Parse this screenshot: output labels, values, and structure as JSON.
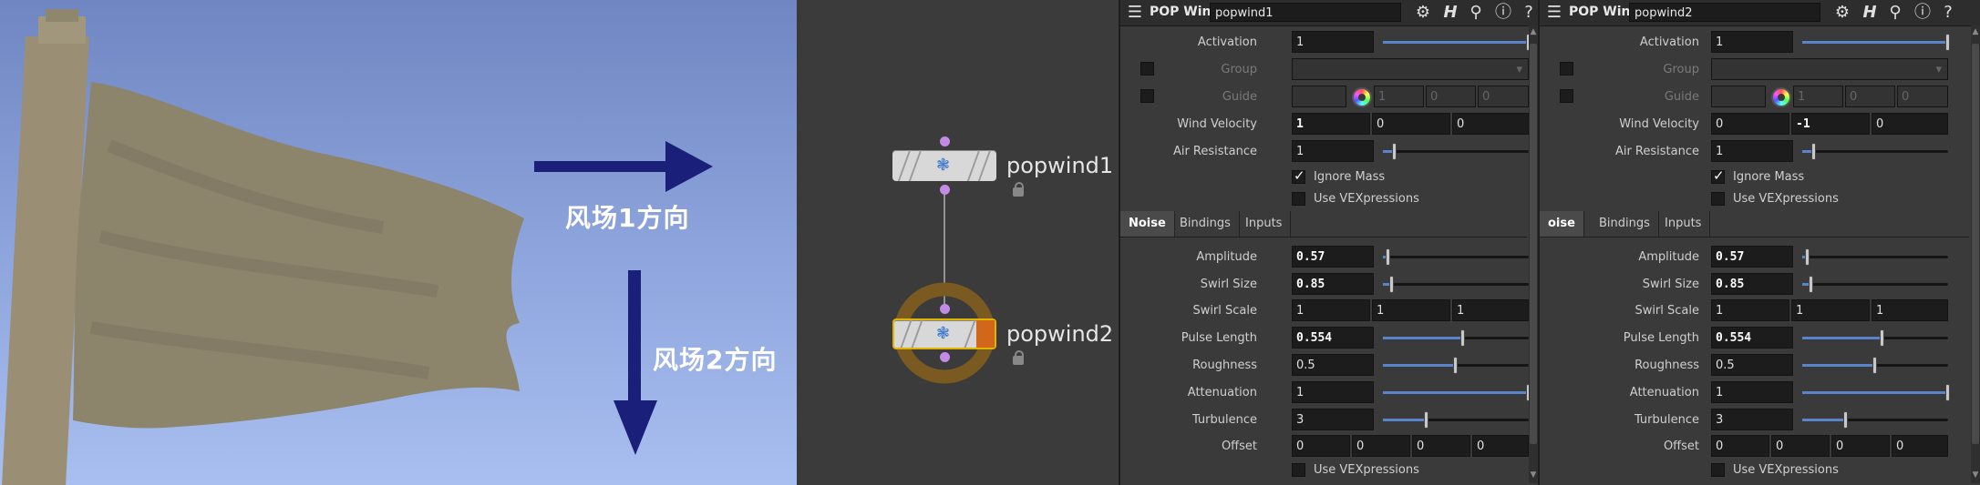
{
  "viewport": {
    "wind1_label": "风场1方向",
    "wind2_label": "风场2方向"
  },
  "network": {
    "nodes": [
      {
        "name": "popwind1"
      },
      {
        "name": "popwind2"
      }
    ]
  },
  "panels": [
    {
      "type_title": "POP Wind",
      "node_name": "popwind1",
      "params": {
        "activation": {
          "label": "Activation",
          "value": "1",
          "slider": 1.0
        },
        "group": {
          "label": "Group"
        },
        "guide": {
          "label": "Guide",
          "v1": "1",
          "v2": "0",
          "v3": "0"
        },
        "wind_velocity": {
          "label": "Wind Velocity",
          "x": "1",
          "y": "0",
          "z": "0"
        },
        "air_resistance": {
          "label": "Air Resistance",
          "value": "1",
          "slider": 0.08
        },
        "ignore_mass": {
          "label": "Ignore Mass",
          "checked": true
        },
        "use_vex": {
          "label": "Use VEXpressions",
          "checked": false
        }
      },
      "tabs": [
        "Noise",
        "Bindings",
        "Inputs"
      ],
      "noise": {
        "amplitude": {
          "label": "Amplitude",
          "value": "0.57",
          "slider": 0.04
        },
        "swirl_size": {
          "label": "Swirl Size",
          "value": "0.85",
          "slider": 0.06
        },
        "swirl_scale": {
          "label": "Swirl Scale",
          "v1": "1",
          "v2": "1",
          "v3": "1"
        },
        "pulse_length": {
          "label": "Pulse Length",
          "value": "0.554",
          "slider": 0.55
        },
        "roughness": {
          "label": "Roughness",
          "value": "0.5",
          "slider": 0.5
        },
        "attenuation": {
          "label": "Attenuation",
          "value": "1",
          "slider": 1.0
        },
        "turbulence": {
          "label": "Turbulence",
          "value": "3",
          "slider": 0.3
        },
        "offset": {
          "label": "Offset",
          "v1": "0",
          "v2": "0",
          "v3": "0",
          "v4": "0"
        },
        "use_vex2": {
          "label": "Use VEXpressions"
        }
      }
    },
    {
      "type_title": "POP Wind",
      "node_name": "popwind2",
      "params": {
        "activation": {
          "label": "Activation",
          "value": "1",
          "slider": 1.0
        },
        "group": {
          "label": "Group"
        },
        "guide": {
          "label": "Guide",
          "v1": "1",
          "v2": "0",
          "v3": "0"
        },
        "wind_velocity": {
          "label": "Wind Velocity",
          "x": "0",
          "y": "-1",
          "z": "0"
        },
        "air_resistance": {
          "label": "Air Resistance",
          "value": "1",
          "slider": 0.08
        },
        "ignore_mass": {
          "label": "Ignore Mass",
          "checked": true
        },
        "use_vex": {
          "label": "Use VEXpressions",
          "checked": false
        }
      },
      "tabs": [
        "oise",
        "Bindings",
        "Inputs"
      ],
      "noise": {
        "amplitude": {
          "label": "Amplitude",
          "value": "0.57",
          "slider": 0.04
        },
        "swirl_size": {
          "label": "Swirl Size",
          "value": "0.85",
          "slider": 0.06
        },
        "swirl_scale": {
          "label": "Swirl Scale",
          "v1": "1",
          "v2": "1",
          "v3": "1"
        },
        "pulse_length": {
          "label": "Pulse Length",
          "value": "0.554",
          "slider": 0.55
        },
        "roughness": {
          "label": "Roughness",
          "value": "0.5",
          "slider": 0.5
        },
        "attenuation": {
          "label": "Attenuation",
          "value": "1",
          "slider": 1.0
        },
        "turbulence": {
          "label": "Turbulence",
          "value": "3",
          "slider": 0.3
        },
        "offset": {
          "label": "Offset",
          "v1": "0",
          "v2": "0",
          "v3": "0",
          "v4": "0"
        },
        "use_vex2": {
          "label": "Use VEXpressions"
        }
      }
    }
  ]
}
